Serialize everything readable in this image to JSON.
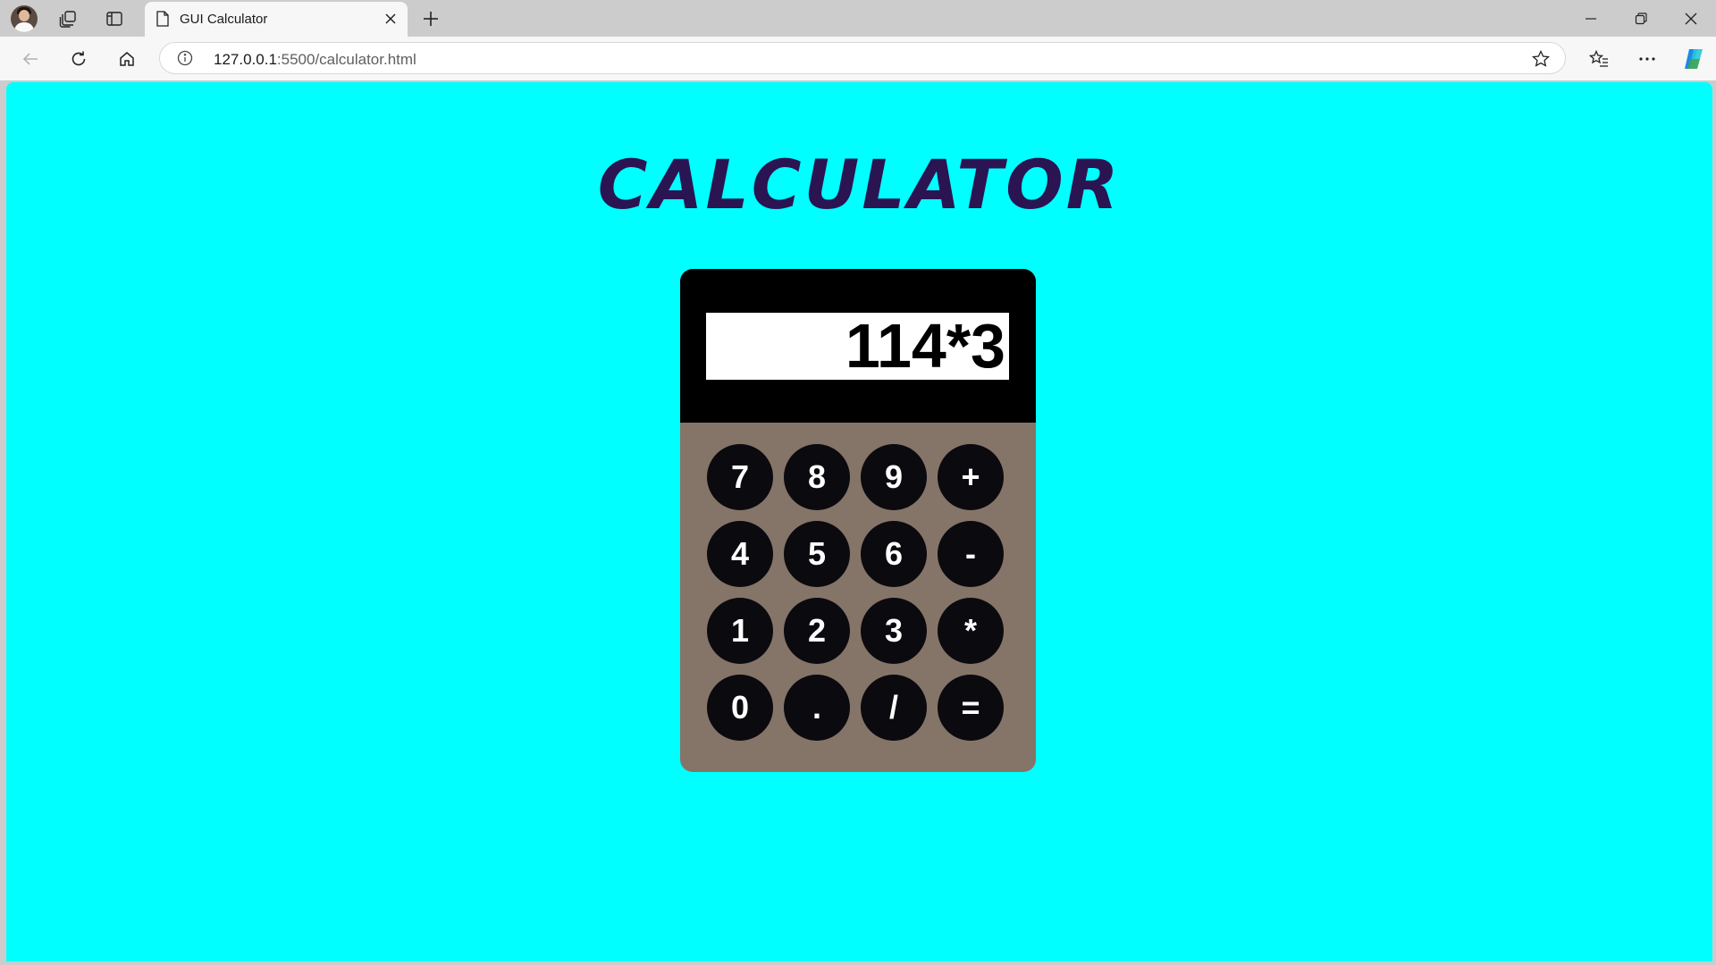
{
  "browser": {
    "tab_title": "GUI Calculator",
    "url_host": "127.0.0.1",
    "url_path": ":5500/calculator.html"
  },
  "page": {
    "title": "CALCULATOR",
    "background_color": "#00ffff",
    "title_color": "#2b1452"
  },
  "calculator": {
    "display_value": "114*3",
    "body_color": "#857468",
    "display_bezel_color": "#000000",
    "key_color": "#0b0a0f",
    "keys": [
      {
        "label": "7",
        "name": "key-7"
      },
      {
        "label": "8",
        "name": "key-8"
      },
      {
        "label": "9",
        "name": "key-9"
      },
      {
        "label": "+",
        "name": "key-plus"
      },
      {
        "label": "4",
        "name": "key-4"
      },
      {
        "label": "5",
        "name": "key-5"
      },
      {
        "label": "6",
        "name": "key-6"
      },
      {
        "label": "-",
        "name": "key-minus"
      },
      {
        "label": "1",
        "name": "key-1"
      },
      {
        "label": "2",
        "name": "key-2"
      },
      {
        "label": "3",
        "name": "key-3"
      },
      {
        "label": "*",
        "name": "key-multiply"
      },
      {
        "label": "0",
        "name": "key-0"
      },
      {
        "label": ".",
        "name": "key-decimal"
      },
      {
        "label": "/",
        "name": "key-divide"
      },
      {
        "label": "=",
        "name": "key-equals"
      }
    ]
  }
}
